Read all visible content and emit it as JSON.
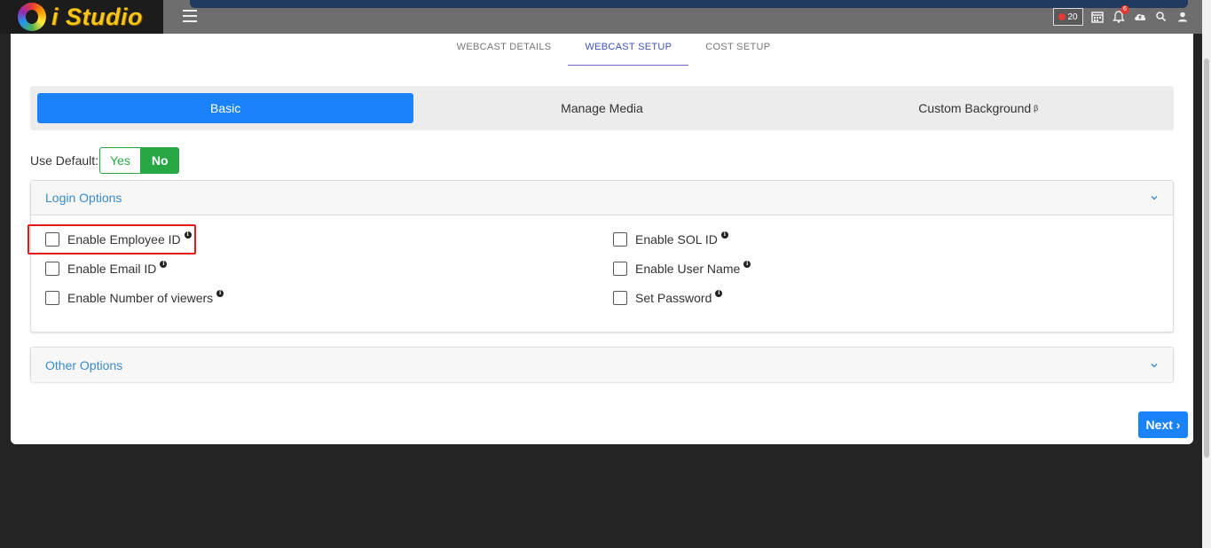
{
  "app": {
    "name": "i Studio"
  },
  "header": {
    "live_count": "20",
    "notification_count": "6",
    "icons": [
      "menu-icon",
      "calendar-icon",
      "bell-icon",
      "cloud-upload-icon",
      "search-icon",
      "user-icon"
    ]
  },
  "tabs": [
    {
      "label": "WEBCAST DETAILS",
      "active": false
    },
    {
      "label": "WEBCAST SETUP",
      "active": true
    },
    {
      "label": "COST SETUP",
      "active": false
    }
  ],
  "subtabs": [
    {
      "label": "Basic",
      "active": true
    },
    {
      "label": "Manage Media",
      "active": false
    },
    {
      "label": "Custom Background",
      "suffix": "β",
      "active": false
    }
  ],
  "use_default": {
    "label": "Use Default:",
    "yes": "Yes",
    "no": "No",
    "selected": "No"
  },
  "login_options": {
    "title": "Login Options",
    "options": [
      {
        "label": "Enable Employee ID",
        "checked": false
      },
      {
        "label": "Enable Email ID",
        "checked": false
      },
      {
        "label": "Enable Number of viewers",
        "checked": false
      },
      {
        "label": "Enable SOL ID",
        "checked": false
      },
      {
        "label": "Enable User Name",
        "checked": false
      },
      {
        "label": "Set Password",
        "checked": false
      }
    ]
  },
  "other_options": {
    "title": "Other Options"
  },
  "footer": {
    "next_label": "Next ›"
  },
  "colors": {
    "primary": "#1a82fb",
    "success": "#28a745",
    "accent_tab": "#3f51b5",
    "highlight": "#e11919"
  }
}
